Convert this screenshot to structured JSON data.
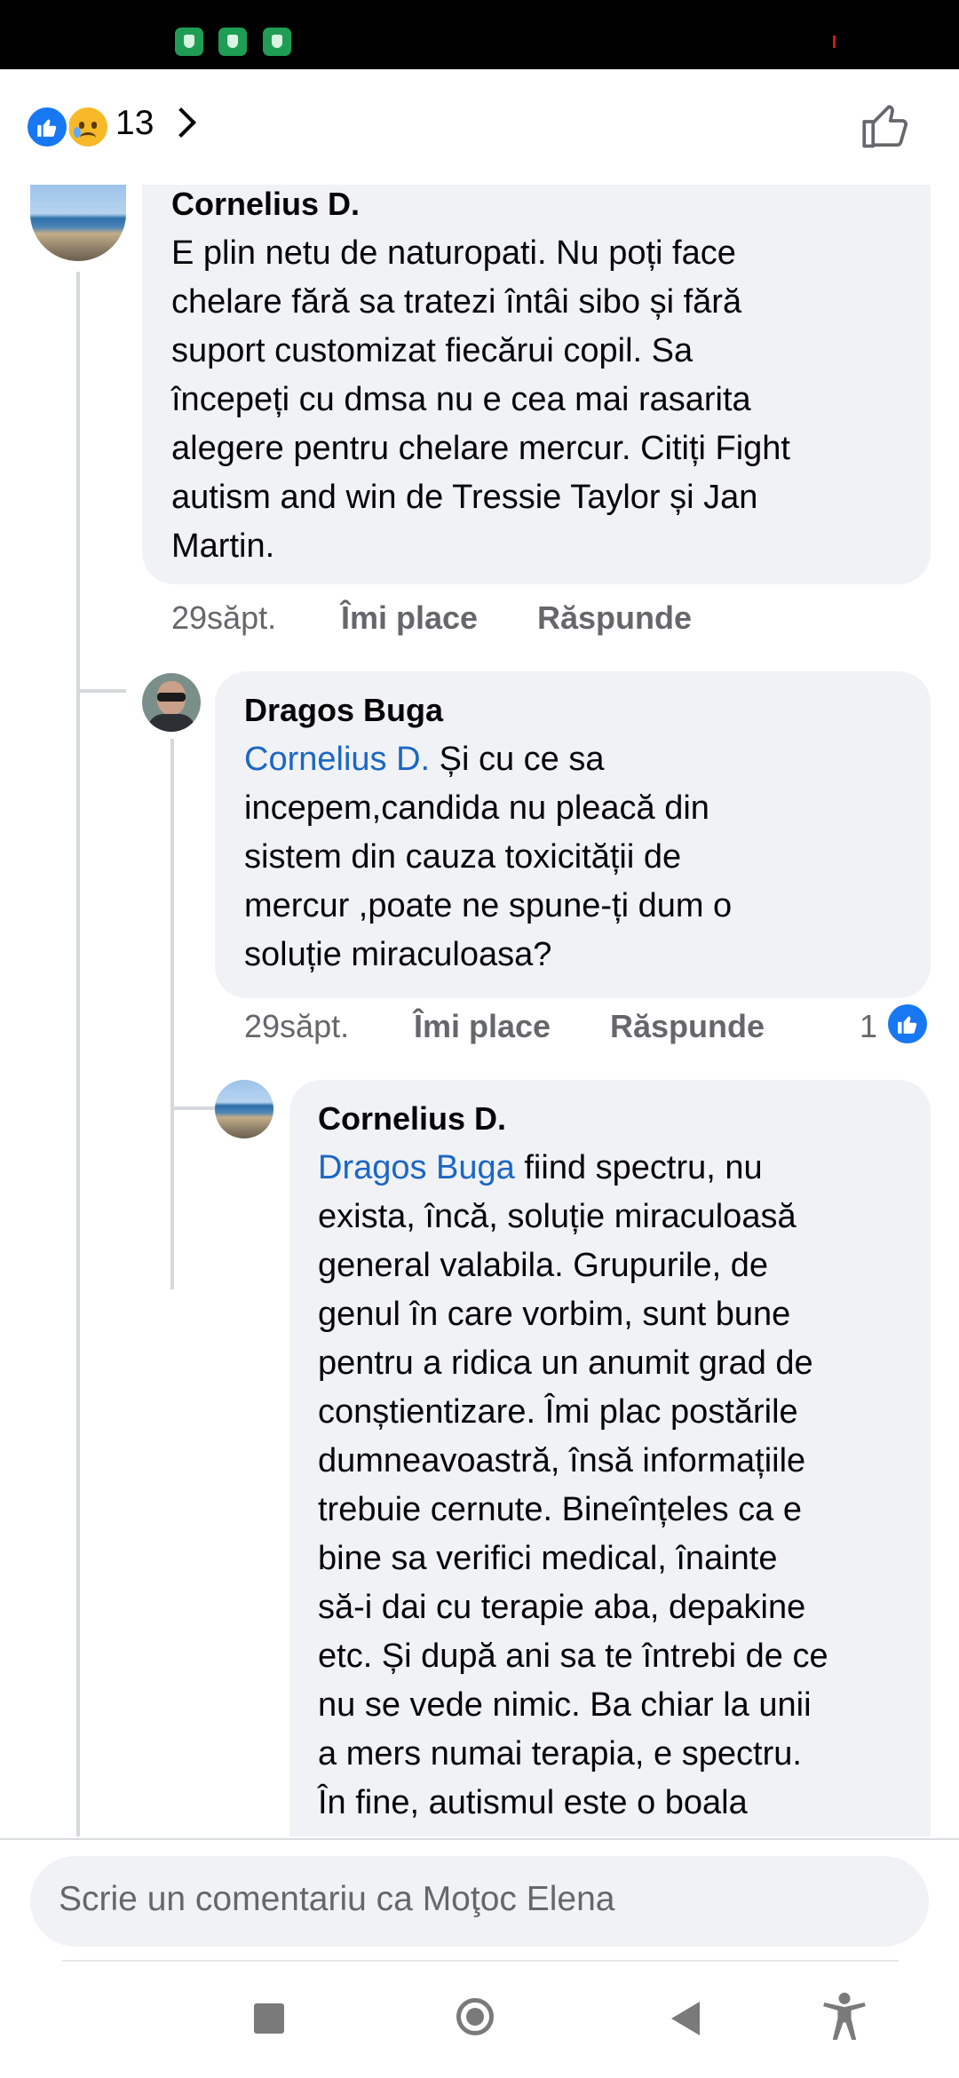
{
  "reactions": {
    "count": "13"
  },
  "comments": [
    {
      "author": "Cornelius D.",
      "lines": [
        "E plin netu de naturopati. Nu poți face",
        "chelare fără sa tratezi întâi sibo și fără",
        "suport customizat fiecărui copil. Sa",
        "începeți cu dmsa nu e cea mai rasarita",
        "alegere pentru chelare mercur. Citiți Fight",
        "autism and win de Tressie Taylor și Jan",
        "Martin."
      ],
      "time": "29săpt.",
      "like_label": "Îmi place",
      "reply_label": "Răspunde"
    },
    {
      "author": "Dragos Buga",
      "mention": "Cornelius D.",
      "lines": [
        " Și cu ce sa",
        "incepem,candida nu pleacă din",
        "sistem din cauza toxicității de",
        "mercur ,poate ne spune-ți dum o",
        "soluție miraculoasa?"
      ],
      "time": "29săpt.",
      "like_label": "Îmi place",
      "reply_label": "Răspunde",
      "like_count": "1"
    },
    {
      "author": "Cornelius D.",
      "mention": "Dragos Buga",
      "lines": [
        " fiind spectru, nu",
        "exista, încă, soluție miraculoasă",
        "general valabila. Grupurile, de",
        "genul în care vorbim, sunt bune",
        "pentru a ridica un anumit grad de",
        "conștientizare. Îmi plac postările",
        "dumneavoastră, însă informațiile",
        "trebuie cernute. Bineînțeles ca e",
        "bine sa verifici medical, înainte",
        "să-i dai cu terapie aba, depakine",
        "etc. Și după ani sa te întrebi de ce",
        "nu se vede nimic. Ba chiar la unii",
        "a mers numai terapia, e spectru.",
        "În fine, autismul este o boala"
      ]
    }
  ],
  "composer": {
    "placeholder": "Scrie un comentariu ca Moţoc Elena"
  },
  "icons": [
    "shield-icon",
    "like-reaction-icon",
    "sad-reaction-icon",
    "chevron-right-icon",
    "thumbs-up-outline-icon",
    "recents-icon",
    "home-icon",
    "back-icon",
    "accessibility-icon"
  ]
}
